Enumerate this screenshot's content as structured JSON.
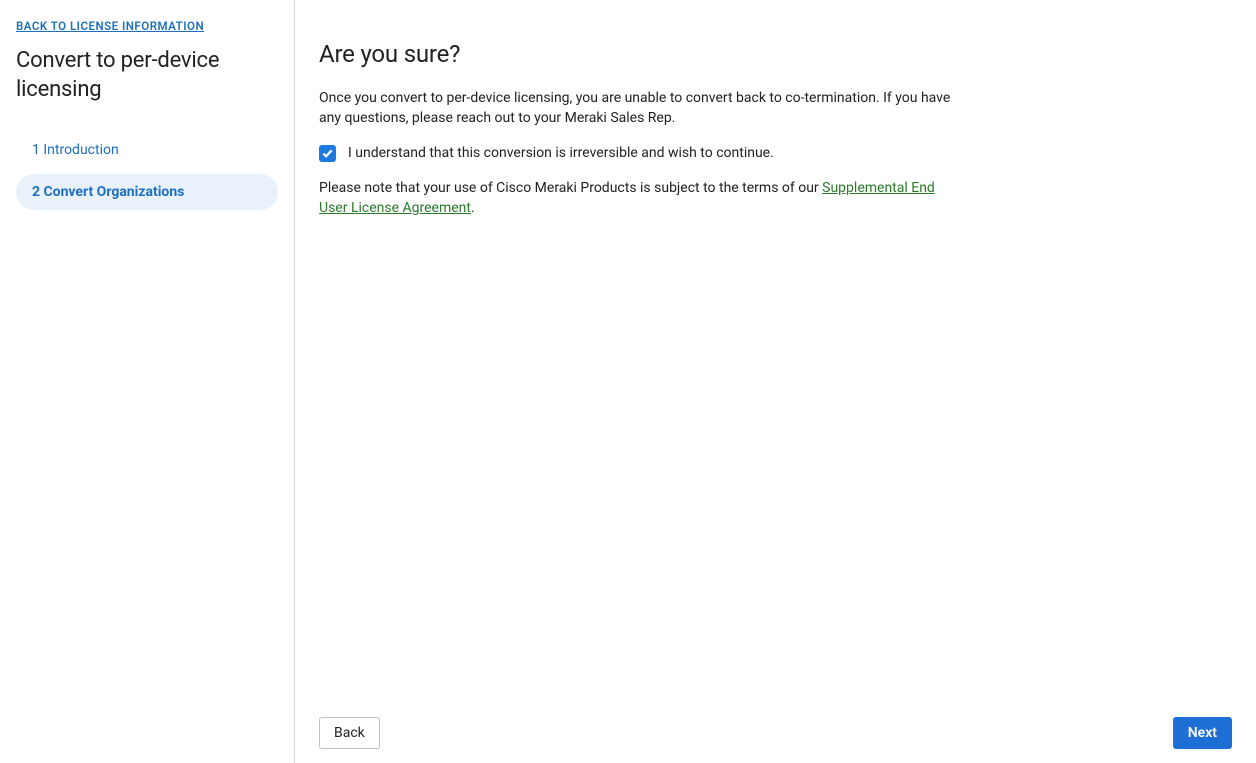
{
  "sidebar": {
    "back_link": "BACK TO LICENSE INFORMATION",
    "title": "Convert to per-device licensing",
    "steps": [
      {
        "label": "1 Introduction"
      },
      {
        "label": "2 Convert Organizations"
      }
    ]
  },
  "main": {
    "heading": "Are you sure?",
    "warning_text": "Once you convert to per-device licensing, you are unable to convert back to co-termination. If you have any questions, please reach out to your Meraki Sales Rep.",
    "checkbox_label": "I understand that this conversion is irreversible and wish to continue.",
    "eula_prefix": "Please note that your use of Cisco Meraki Products is subject to the terms of our ",
    "eula_link": "Supplemental End User License Agreement",
    "eula_suffix": "."
  },
  "footer": {
    "back_label": "Back",
    "next_label": "Next"
  }
}
